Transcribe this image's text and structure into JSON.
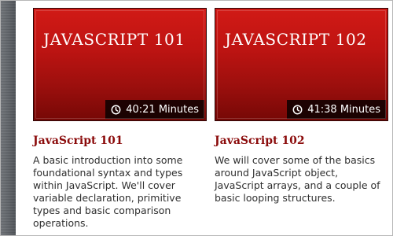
{
  "courses": [
    {
      "thumb_title": "JavaScript 101",
      "duration": "40:21 Minutes",
      "title": "JavaScript 101",
      "description": "A basic introduction into some foundational syntax and types within JavaScript. We'll cover variable declaration, primitive types and basic comparison operations."
    },
    {
      "thumb_title": "JavaScript 102",
      "duration": "41:38 Minutes",
      "title": "JavaScript 102",
      "description": "We will cover some of the basics around JavaScript object, JavaScript arrays, and a couple of basic looping structures."
    }
  ],
  "colors": {
    "accent": "#8b0b0b",
    "thumb_red": "#c51512"
  },
  "icons": {
    "duration": "clock-icon"
  }
}
